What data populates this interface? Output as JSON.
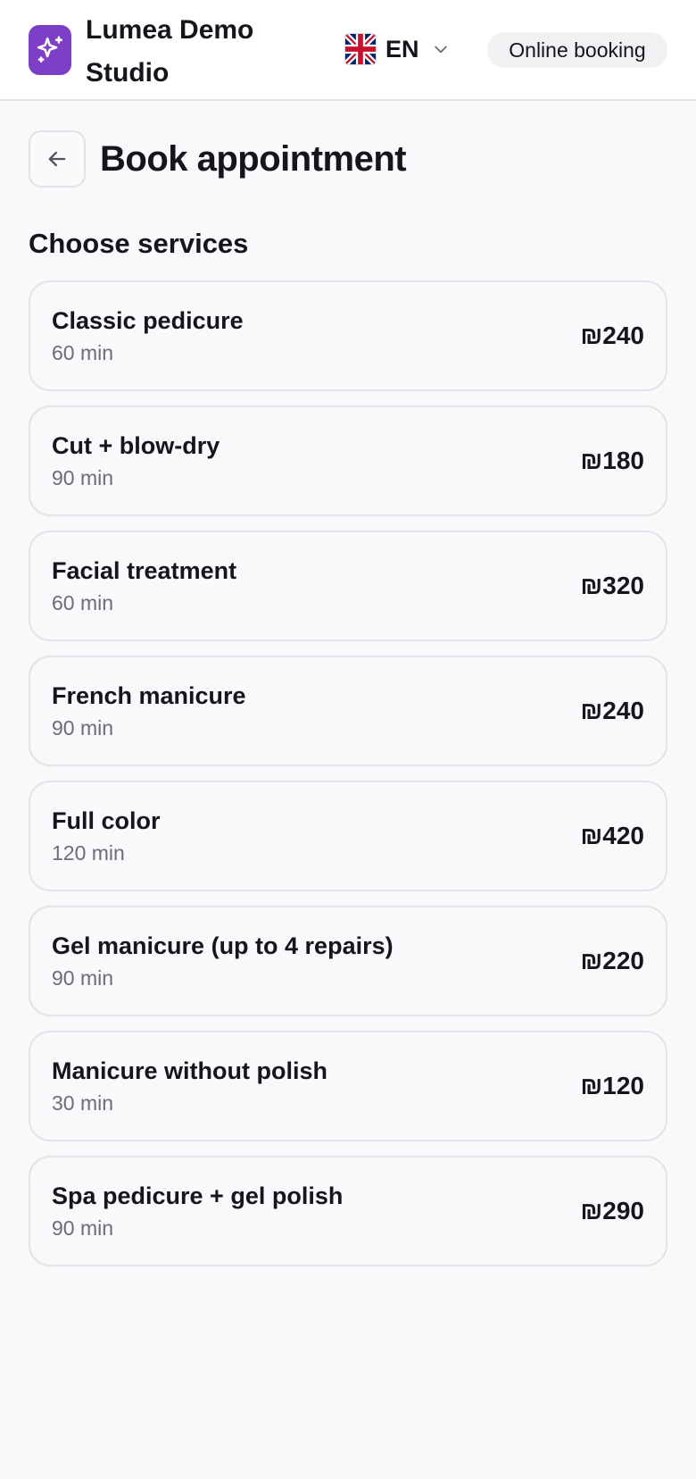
{
  "header": {
    "brand_name": "Lumea Demo Studio",
    "brand_color": "#7c3fc6",
    "logo_icon": "sparkles-icon",
    "language": {
      "flag": "uk-flag-icon",
      "code": "EN"
    },
    "badge": "Online booking"
  },
  "page": {
    "back_icon": "arrow-left-icon",
    "title": "Book appointment"
  },
  "services_section": {
    "title": "Choose services",
    "items": [
      {
        "name": "Classic pedicure",
        "duration": "60 min",
        "price": "₪240"
      },
      {
        "name": "Cut + blow-dry",
        "duration": "90 min",
        "price": "₪180"
      },
      {
        "name": "Facial treatment",
        "duration": "60 min",
        "price": "₪320"
      },
      {
        "name": "French manicure",
        "duration": "90 min",
        "price": "₪240"
      },
      {
        "name": "Full color",
        "duration": "120 min",
        "price": "₪420"
      },
      {
        "name": "Gel manicure (up to 4 repairs)",
        "duration": "90 min",
        "price": "₪220"
      },
      {
        "name": "Manicure without polish",
        "duration": "30 min",
        "price": "₪120"
      },
      {
        "name": "Spa pedicure + gel polish",
        "duration": "90 min",
        "price": "₪290"
      }
    ]
  }
}
